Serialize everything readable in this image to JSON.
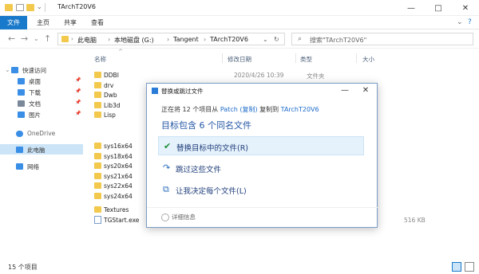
{
  "window": {
    "title": "TArchT20V6",
    "minimize": "—",
    "maximize": "□",
    "close": "✕"
  },
  "ribbon": {
    "tabs": [
      "文件",
      "主页",
      "共享",
      "查看"
    ],
    "collapse": "⌄",
    "help": "?"
  },
  "nav": {
    "back": "←",
    "forward": "→",
    "recent": "⌄",
    "up": "↑",
    "breadcrumb": [
      "此电脑",
      "本地磁盘 (G:)",
      "Tangent",
      "TArchT20V6"
    ],
    "refresh": "↻",
    "search_placeholder": "搜索\"TArchT20V6\""
  },
  "sidebar": {
    "items": [
      {
        "label": "快速访问",
        "pinned": false,
        "color": "#3a8ee6"
      },
      {
        "label": "桌面",
        "pinned": true,
        "color": "#3a8ee6"
      },
      {
        "label": "下载",
        "pinned": true,
        "color": "#3a8ee6"
      },
      {
        "label": "文档",
        "pinned": true,
        "color": "#7a8899"
      },
      {
        "label": "图片",
        "pinned": true,
        "color": "#3a8ee6"
      },
      {
        "label": "OneDrive",
        "pinned": false,
        "color": "#3a8ee6"
      },
      {
        "label": "此电脑",
        "pinned": false,
        "color": "#3a8ee6"
      },
      {
        "label": "网络",
        "pinned": false,
        "color": "#3a8ee6"
      }
    ]
  },
  "columns": {
    "name": "名称",
    "date": "修改日期",
    "type": "类型",
    "size": "大小"
  },
  "files": [
    {
      "name": "DDBI",
      "date": "2020/4/26 10:39",
      "type": "文件夹",
      "size": "",
      "kind": "folder"
    },
    {
      "name": "drv",
      "date": "",
      "type": "",
      "size": "",
      "kind": "folder"
    },
    {
      "name": "Dwb",
      "date": "",
      "type": "",
      "size": "",
      "kind": "folder"
    },
    {
      "name": "Lib3d",
      "date": "",
      "type": "",
      "size": "",
      "kind": "folder"
    },
    {
      "name": "Lisp",
      "date": "",
      "type": "",
      "size": "",
      "kind": "folder"
    },
    {
      "name": "sys16x64",
      "date": "",
      "type": "",
      "size": "",
      "kind": "folder"
    },
    {
      "name": "sys18x64",
      "date": "",
      "type": "",
      "size": "",
      "kind": "folder"
    },
    {
      "name": "sys20x64",
      "date": "",
      "type": "",
      "size": "",
      "kind": "folder"
    },
    {
      "name": "sys21x64",
      "date": "",
      "type": "",
      "size": "",
      "kind": "folder"
    },
    {
      "name": "sys22x64",
      "date": "",
      "type": "",
      "size": "",
      "kind": "folder"
    },
    {
      "name": "sys24x64",
      "date": "",
      "type": "",
      "size": "",
      "kind": "folder"
    },
    {
      "name": "Textures",
      "date": "",
      "type": "",
      "size": "",
      "kind": "folder"
    },
    {
      "name": "TGStart.exe",
      "date": "",
      "type": "",
      "size": "516 KB",
      "kind": "file"
    }
  ],
  "status": {
    "count": "15 个项目"
  },
  "dialog": {
    "title": "替换或跳过文件",
    "line1_prefix": "正在将 12 个项目从",
    "line1_source": "Patch (复制)",
    "line1_mid": "复制到",
    "line1_dest": "TArchT20V6",
    "heading": "目标包含 6 个同名文件",
    "options": [
      {
        "icon": "✔",
        "label": "替换目标中的文件(R)",
        "selected": true
      },
      {
        "icon": "↷",
        "label": "跳过这些文件",
        "selected": false
      },
      {
        "icon": "⧉",
        "label": "让我决定每个文件(L)",
        "selected": false
      }
    ],
    "details": "详细信息",
    "min": "—",
    "close": "✕"
  },
  "colors": {
    "accent": "#1979ca",
    "selection": "#cce4f7",
    "folder": "#f2c94c",
    "dialog_heading": "#2457a6"
  }
}
